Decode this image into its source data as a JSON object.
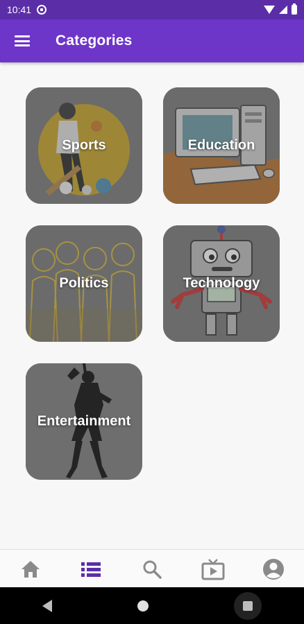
{
  "status_bar": {
    "time": "10:41"
  },
  "app_bar": {
    "title": "Categories"
  },
  "categories": [
    {
      "label": "Sports"
    },
    {
      "label": "Education"
    },
    {
      "label": "Politics"
    },
    {
      "label": "Technology"
    },
    {
      "label": "Entertainment"
    }
  ],
  "bottom_nav": {
    "items": [
      "home-icon",
      "list-icon",
      "search-icon",
      "tv-icon",
      "account-icon"
    ],
    "active_index": 1
  },
  "colors": {
    "status_bar": "#5b2ea8",
    "app_bar": "#6d35c8",
    "nav_active": "#5b2ea8",
    "nav_inactive": "#8a8a8a"
  }
}
